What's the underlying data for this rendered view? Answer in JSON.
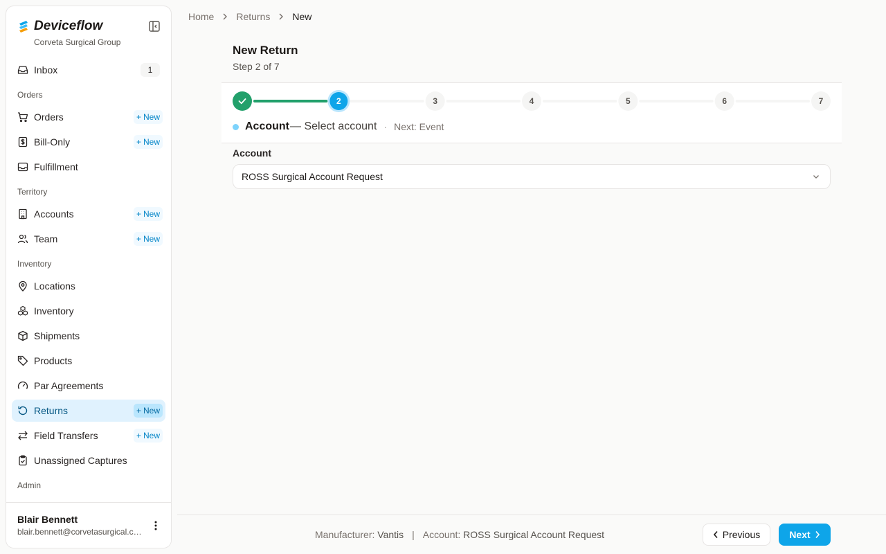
{
  "brand": {
    "name": "Deviceflow",
    "org": "Corveta Surgical Group",
    "logo_colors": [
      "#0ea5e9",
      "#f59e0b"
    ]
  },
  "sidebar": {
    "inbox": {
      "label": "Inbox",
      "icon": "inbox-icon",
      "count": "1"
    },
    "sections": {
      "orders": "Orders",
      "territory": "Territory",
      "inventory": "Inventory",
      "admin": "Admin"
    },
    "new_label": "New",
    "items": {
      "orders": {
        "label": "Orders",
        "icon": "cart-icon"
      },
      "bill_only": {
        "label": "Bill-Only",
        "icon": "receipt-dollar-icon"
      },
      "fulfillment": {
        "label": "Fulfillment",
        "icon": "tray-icon"
      },
      "accounts": {
        "label": "Accounts",
        "icon": "building-icon"
      },
      "team": {
        "label": "Team",
        "icon": "users-icon"
      },
      "locations": {
        "label": "Locations",
        "icon": "map-pin-icon"
      },
      "inventory": {
        "label": "Inventory",
        "icon": "boxes-icon"
      },
      "shipments": {
        "label": "Shipments",
        "icon": "package-icon"
      },
      "products": {
        "label": "Products",
        "icon": "tag-icon"
      },
      "par_agreements": {
        "label": "Par Agreements",
        "icon": "gauge-icon"
      },
      "returns": {
        "label": "Returns",
        "icon": "rotate-ccw-icon",
        "active": true
      },
      "field_transfers": {
        "label": "Field Transfers",
        "icon": "arrows-swap-icon"
      },
      "unassigned_captures": {
        "label": "Unassigned Captures",
        "icon": "clipboard-check-icon"
      }
    }
  },
  "user": {
    "name": "Blair Bennett",
    "email": "blair.bennett@corvetasurgical.com"
  },
  "breadcrumb": [
    "Home",
    "Returns",
    "New"
  ],
  "page": {
    "title": "New Return",
    "step_text": "Step 2 of 7"
  },
  "stepper": {
    "total": 7,
    "current": 2,
    "labels": [
      "1",
      "2",
      "3",
      "4",
      "5",
      "6",
      "7"
    ],
    "current_name": "Account",
    "current_desc": "— Select account",
    "separator": "·",
    "next_text": "Next: Event",
    "colors": {
      "done": "#22a06b",
      "active": "#0ea5e9",
      "pending": "#f5f5f4"
    }
  },
  "form": {
    "account_label": "Account",
    "account_value": "ROSS Surgical Account Request"
  },
  "footer": {
    "manufacturer_label": "Manufacturer:",
    "manufacturer_value": "Vantis",
    "pipe": "|",
    "account_label": "Account:",
    "account_value": "ROSS Surgical Account Request",
    "previous": "Previous",
    "next": "Next"
  }
}
